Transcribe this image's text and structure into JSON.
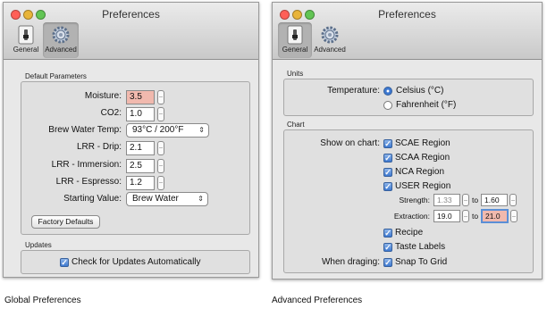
{
  "colors": {
    "close": "#ff5f57",
    "minimize": "#e8b43a",
    "maximize": "#62c554",
    "accent": "#3d78d0",
    "highlight": "#f1b9ae"
  },
  "global_window": {
    "title": "Preferences",
    "toolbar": [
      {
        "label": "General",
        "icon": "switch-icon",
        "selected": false
      },
      {
        "label": "Advanced",
        "icon": "gear-icon",
        "selected": true
      }
    ],
    "section_default": "Default Parameters",
    "fields": {
      "moisture": {
        "label": "Moisture:",
        "value": "3.5"
      },
      "co2": {
        "label": "CO2:",
        "value": "1.0"
      },
      "brew_temp": {
        "label": "Brew Water Temp:",
        "value": "93°C / 200°F"
      },
      "lrr_drip": {
        "label": "LRR - Drip:",
        "value": "2.1"
      },
      "lrr_immersion": {
        "label": "LRR - Immersion:",
        "value": "2.5"
      },
      "lrr_espresso": {
        "label": "LRR - Espresso:",
        "value": "1.2"
      },
      "starting_value": {
        "label": "Starting Value:",
        "value": "Brew Water"
      }
    },
    "factory_defaults": "Factory Defaults",
    "section_updates": "Updates",
    "updates_checkbox": "Check for Updates Automatically"
  },
  "advanced_window": {
    "title": "Preferences",
    "toolbar": [
      {
        "label": "General",
        "icon": "switch-icon",
        "selected": true
      },
      {
        "label": "Advanced",
        "icon": "gear-icon",
        "selected": false
      }
    ],
    "section_units": "Units",
    "temperature_label": "Temperature:",
    "celsius": "Celsius (°C)",
    "fahrenheit": "Fahrenheit (°F)",
    "section_chart": "Chart",
    "show_on_chart": "Show on chart:",
    "regions": [
      "SCAE Region",
      "SCAA Region",
      "NCA Region",
      "USER Region"
    ],
    "strength_label": "Strength:",
    "strength_from": "1.33",
    "strength_to": "1.60",
    "extraction_label": "Extraction:",
    "extraction_from": "19.0",
    "extraction_to": "21.0",
    "to": "to",
    "recipe": "Recipe",
    "taste_labels": "Taste Labels",
    "when_dragging": "When draging:",
    "snap_to_grid": "Snap To Grid"
  },
  "captions": {
    "global": "Global Preferences",
    "advanced": "Advanced Preferences"
  }
}
